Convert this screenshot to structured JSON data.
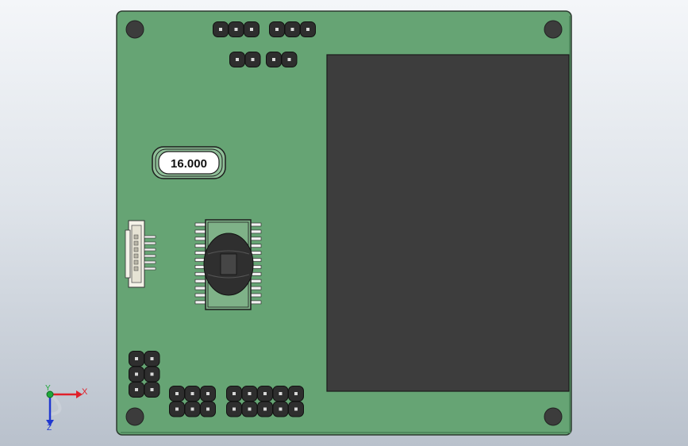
{
  "viewport": {
    "background_top": "#f4f6f9",
    "background_bottom": "#b9c1cc"
  },
  "board": {
    "pcb_color": "#66a474",
    "outline_color": "#2b3a2f",
    "mounting_hole_color": "#3c3c3c"
  },
  "display": {
    "color": "#3d3d3d"
  },
  "crystal": {
    "label": "16.000"
  },
  "triad": {
    "x_label": "X",
    "y_label": "Y",
    "z_label": "Z",
    "x_color": "#e0202a",
    "y_color": "#1fa83a",
    "z_color": "#2038d0"
  }
}
